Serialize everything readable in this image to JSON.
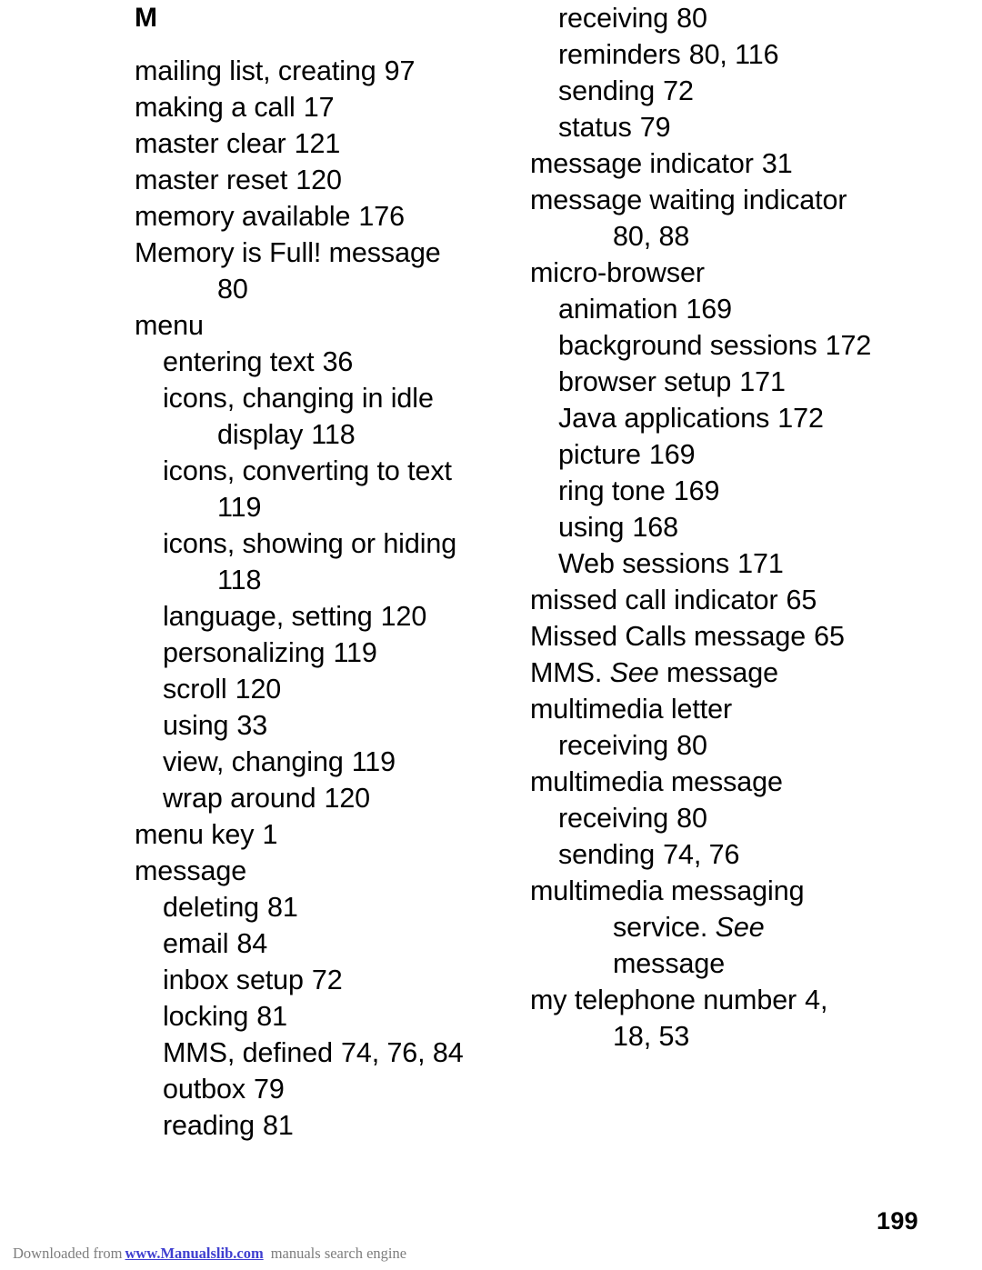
{
  "document": {
    "type": "manual-index-page",
    "page_number": "199",
    "section_letter": "M"
  },
  "left_column": {
    "entries": [
      {
        "level": 0,
        "text": "mailing list, creating",
        "page": "97"
      },
      {
        "level": 0,
        "text": "making a call",
        "page": "17"
      },
      {
        "level": 0,
        "text": "master clear",
        "page": "121"
      },
      {
        "level": 0,
        "text": "master reset",
        "page": "120"
      },
      {
        "level": 0,
        "text": "memory available",
        "page": "176"
      },
      {
        "level": 0,
        "text": "Memory is Full! message",
        "page": ""
      },
      {
        "level": 2,
        "text": "80",
        "page": ""
      },
      {
        "level": 0,
        "text": "menu",
        "page": ""
      },
      {
        "level": 1,
        "text": "entering text",
        "page": "36"
      },
      {
        "level": 1,
        "text": "icons, changing in idle",
        "page": ""
      },
      {
        "level": 2,
        "text": "display",
        "page": "118"
      },
      {
        "level": 1,
        "text": "icons, converting to text",
        "page": ""
      },
      {
        "level": 2,
        "text": "119",
        "page": ""
      },
      {
        "level": 1,
        "text": "icons, showing or hiding",
        "page": ""
      },
      {
        "level": 2,
        "text": "118",
        "page": ""
      },
      {
        "level": 1,
        "text": "language, setting",
        "page": "120"
      },
      {
        "level": 1,
        "text": "personalizing",
        "page": "119"
      },
      {
        "level": 1,
        "text": "scroll",
        "page": "120"
      },
      {
        "level": 1,
        "text": "using",
        "page": "33"
      },
      {
        "level": 1,
        "text": "view, changing",
        "page": "119"
      },
      {
        "level": 1,
        "text": "wrap around",
        "page": "120"
      },
      {
        "level": 0,
        "text": "menu key",
        "page": "1"
      },
      {
        "level": 0,
        "text": "message",
        "page": ""
      },
      {
        "level": 1,
        "text": "deleting",
        "page": "81"
      },
      {
        "level": 1,
        "text": "email",
        "page": "84"
      },
      {
        "level": 1,
        "text": "inbox setup",
        "page": "72"
      },
      {
        "level": 1,
        "text": "locking",
        "page": "81"
      },
      {
        "level": 1,
        "text": "MMS, defined",
        "page": "74, 76, 84"
      },
      {
        "level": 1,
        "text": "outbox",
        "page": "79"
      },
      {
        "level": 1,
        "text": "reading",
        "page": "81"
      }
    ]
  },
  "right_column": {
    "entries": [
      {
        "level": 1,
        "text": "receiving",
        "page": "80"
      },
      {
        "level": 1,
        "text": "reminders",
        "page": "80, 116"
      },
      {
        "level": 1,
        "text": "sending",
        "page": "72"
      },
      {
        "level": 1,
        "text": "status",
        "page": "79"
      },
      {
        "level": 0,
        "text": "message indicator",
        "page": "31"
      },
      {
        "level": 0,
        "text": "message waiting indicator",
        "page": ""
      },
      {
        "level": 2,
        "text": "80, 88",
        "page": ""
      },
      {
        "level": 0,
        "text": "micro-browser",
        "page": ""
      },
      {
        "level": 1,
        "text": "animation",
        "page": "169"
      },
      {
        "level": 1,
        "text": "background sessions",
        "page": "172"
      },
      {
        "level": 1,
        "text": "browser setup",
        "page": "171"
      },
      {
        "level": 1,
        "text": "Java applications",
        "page": "172"
      },
      {
        "level": 1,
        "text": "picture",
        "page": "169"
      },
      {
        "level": 1,
        "text": "ring tone",
        "page": "169"
      },
      {
        "level": 1,
        "text": "using",
        "page": "168"
      },
      {
        "level": 1,
        "text": "Web sessions",
        "page": "171"
      },
      {
        "level": 0,
        "text": "missed call indicator",
        "page": "65"
      },
      {
        "level": 0,
        "text": "Missed Calls message",
        "page": "65"
      },
      {
        "level": 0,
        "text": "MMS. ",
        "italic": "See",
        "after": " message",
        "page": ""
      },
      {
        "level": 0,
        "text": "multimedia letter",
        "page": ""
      },
      {
        "level": 1,
        "text": "receiving",
        "page": "80"
      },
      {
        "level": 0,
        "text": "multimedia message",
        "page": ""
      },
      {
        "level": 1,
        "text": "receiving",
        "page": "80"
      },
      {
        "level": 1,
        "text": "sending",
        "page": "74, 76"
      },
      {
        "level": 0,
        "text": "multimedia messaging",
        "page": ""
      },
      {
        "level": 2,
        "text": "service. ",
        "italic": "See",
        "after": "",
        "page": ""
      },
      {
        "level": 2,
        "text": "message",
        "page": ""
      },
      {
        "level": 0,
        "text": "my telephone number",
        "page": "4,"
      },
      {
        "level": 2,
        "text": "18, 53",
        "page": ""
      }
    ]
  },
  "footer": {
    "watermark_prefix": "Downloaded from",
    "watermark_link": "www.Manualslib.com",
    "watermark_suffix": "manuals search engine"
  }
}
